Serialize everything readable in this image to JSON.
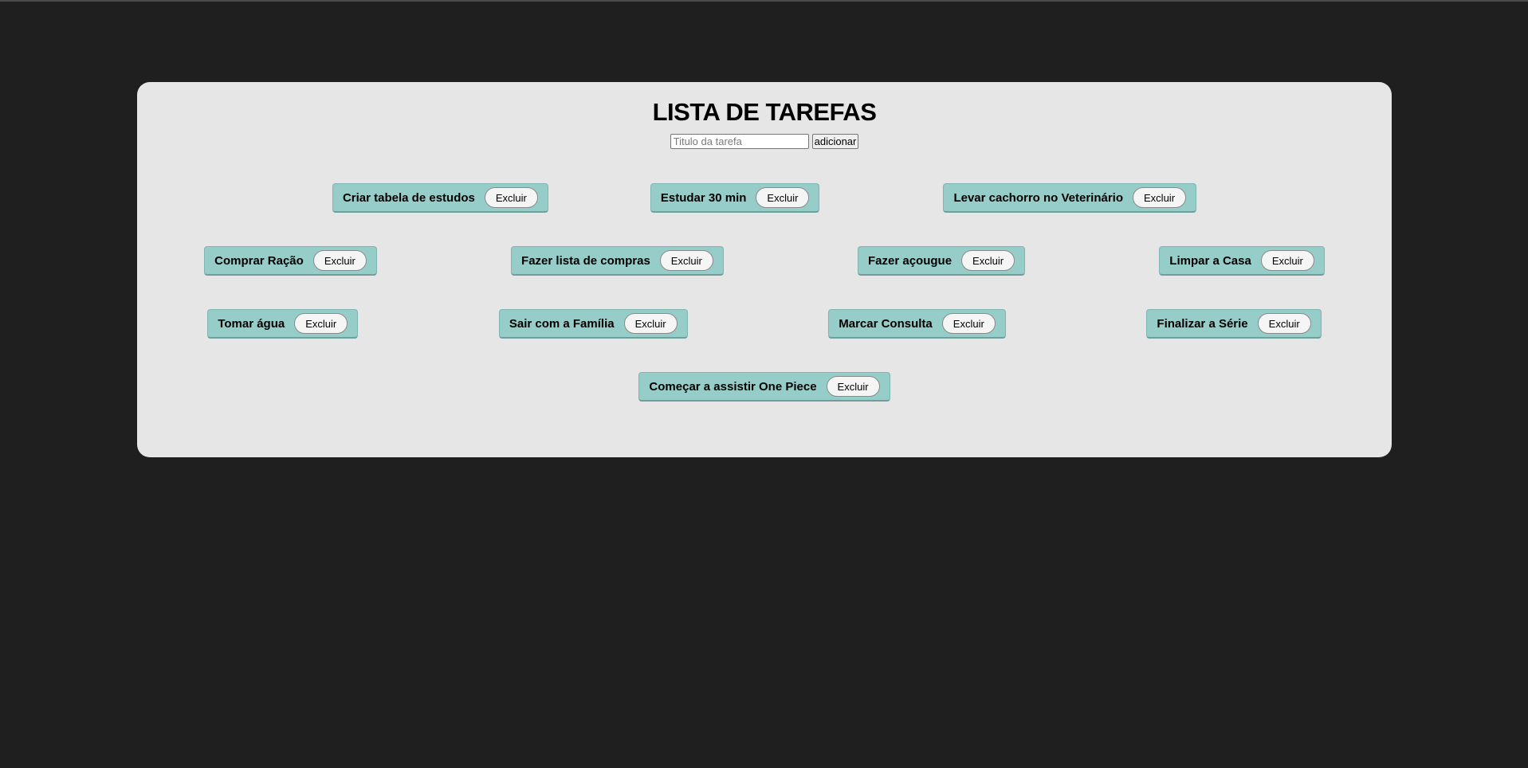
{
  "page": {
    "title": "LISTA DE TAREFAS"
  },
  "form": {
    "input_value": "",
    "input_placeholder": "Titulo da tarefa",
    "add_label": "adicionar"
  },
  "tasks": {
    "delete_label": "Excluir",
    "rows": [
      [
        "Criar tabela de estudos",
        "Estudar 30 min",
        "Levar cachorro no Veterinário"
      ],
      [
        "Comprar Ração",
        "Fazer lista de compras",
        "Fazer açougue",
        "Limpar a Casa"
      ],
      [
        "Tomar água",
        "Sair com a Família",
        "Marcar Consulta",
        "Finalizar a Série"
      ],
      [
        "Começar a assistir One Piece"
      ]
    ]
  },
  "colors": {
    "background": "#1f1f1f",
    "panel": "#e6e6e6",
    "task_card": "#96cdc8",
    "delete_button": "#f5f5f5"
  }
}
